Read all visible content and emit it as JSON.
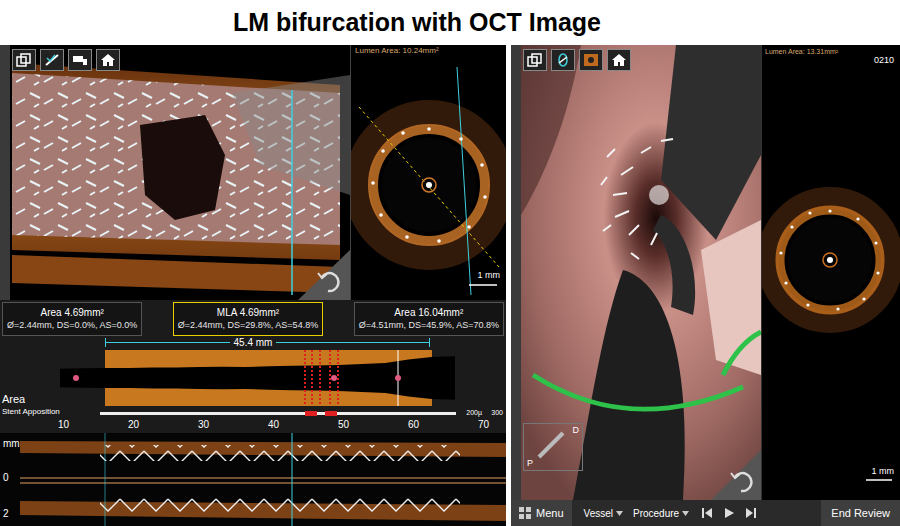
{
  "title": "LM bifurcation with OCT Image",
  "left_panel": {
    "cross_section": {
      "lumen_area": "Lumen Area: 10.24mm²",
      "scale": "1 mm"
    },
    "measurements": [
      {
        "title": "Area 4.69mm²",
        "detail": "Ø=2.44mm, DS=0.0%, AS=0.0%",
        "selected": false
      },
      {
        "title": "MLA 4.69mm²",
        "detail": "Ø=2.44mm, DS=29.8%, AS=54.8%",
        "selected": true
      },
      {
        "title": "Area 16.04mm²",
        "detail": "Ø=4.51mm, DS=45.9%, AS=70.8%",
        "selected": false
      }
    ],
    "length": "45.4 mm",
    "profile": {
      "label": "Area",
      "values": [
        2.2,
        2.3,
        2.4,
        2.4,
        2.5,
        2.5,
        2.6,
        2.7,
        2.6,
        2.8,
        2.9,
        3.0,
        3.1,
        3.3,
        3.6,
        4.4,
        5.0,
        5.2
      ]
    },
    "apposition": {
      "label": "Stent Apposition",
      "scale_min": "200µ",
      "scale_max": "300"
    },
    "axis": {
      "ticks": [
        "10",
        "20",
        "30",
        "40",
        "50",
        "60",
        "70"
      ],
      "left": [
        "mm",
        "0",
        "2"
      ]
    }
  },
  "right_panel": {
    "lumen_area": "Lumen Area: 13.31mm²",
    "frame": "0210",
    "scale": "1 mm",
    "orientation": {
      "distal": "D",
      "proximal": "P"
    },
    "bottom_bar": {
      "menu": "Menu",
      "items": [
        "Vessel",
        "Procedure"
      ],
      "end": "End Review"
    }
  }
}
